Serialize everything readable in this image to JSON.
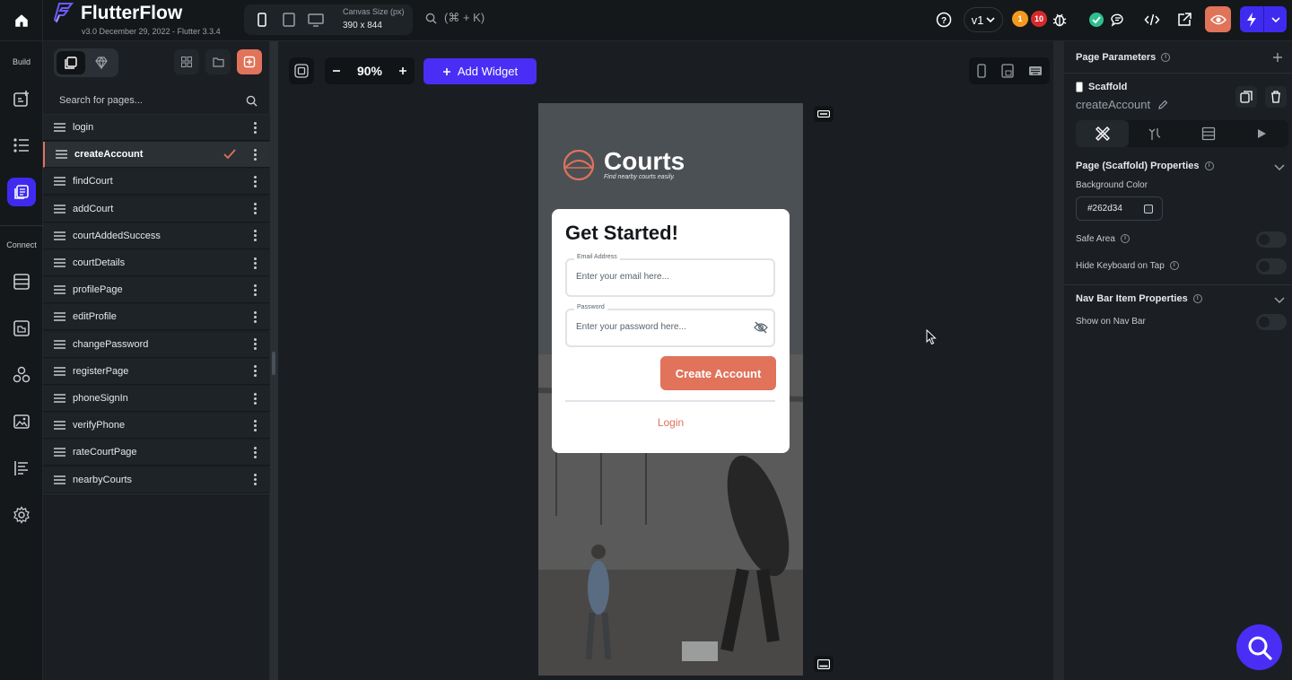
{
  "app": {
    "name": "FlutterFlow",
    "version": "v3.0 December 29, 2022 - Flutter 3.3.4"
  },
  "topbar": {
    "canvas_size_label": "Canvas Size (px)",
    "canvas_size_value": "390 x 844",
    "search_shortcut": "(⌘ + K)",
    "version_label": "v1",
    "warning_count": "1",
    "error_count": "10"
  },
  "rail": {
    "build_label": "Build",
    "connect_label": "Connect"
  },
  "pages_panel": {
    "search_placeholder": "Search for pages...",
    "pages": [
      {
        "label": "login"
      },
      {
        "label": "createAccount"
      },
      {
        "label": "findCourt"
      },
      {
        "label": "addCourt"
      },
      {
        "label": "courtAddedSuccess"
      },
      {
        "label": "courtDetails"
      },
      {
        "label": "profilePage"
      },
      {
        "label": "editProfile"
      },
      {
        "label": "changePassword"
      },
      {
        "label": "registerPage"
      },
      {
        "label": "phoneSignIn"
      },
      {
        "label": "verifyPhone"
      },
      {
        "label": "rateCourtPage"
      },
      {
        "label": "nearbyCourts"
      }
    ],
    "selected_index": 1
  },
  "canvas": {
    "zoom": "90%",
    "add_widget_label": "Add Widget",
    "phone": {
      "logo_title": "Courts",
      "logo_tagline": "Find nearby courts easily.",
      "card_title": "Get Started!",
      "email_label": "Email Address",
      "email_placeholder": "Enter your email here...",
      "password_label": "Password",
      "password_placeholder": "Enter your password here...",
      "create_button": "Create Account",
      "login_link": "Login"
    }
  },
  "properties": {
    "title": "Page Parameters",
    "widget_type": "Scaffold",
    "page_name": "createAccount",
    "section1_title": "Page (Scaffold) Properties",
    "bg_color_label": "Background Color",
    "bg_color_value": "#262d34",
    "safe_area_label": "Safe Area",
    "hide_keyboard_label": "Hide Keyboard on Tap",
    "section2_title": "Nav Bar Item Properties",
    "show_nav_label": "Show on Nav Bar"
  },
  "colors": {
    "accent": "#4a2ef5",
    "brand_orange": "#e0735a",
    "bg_dark": "#14181b"
  }
}
